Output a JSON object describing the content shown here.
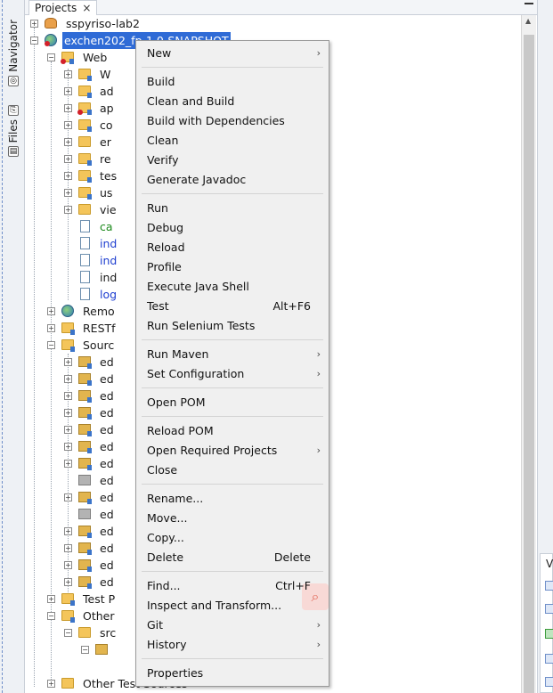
{
  "sidebar_left": {
    "navigator_label": "Navigator",
    "files_label": "Files"
  },
  "panel": {
    "tab_label": "Projects",
    "close_glyph": "×"
  },
  "tree": {
    "project1": "sspyriso-lab2",
    "project2": "exchen202_fp-1.0-SNAPSHOT",
    "web": "Web",
    "web_children": [
      "W",
      "ad",
      "ap",
      "co",
      "er",
      "re",
      "tes",
      "us",
      "vie"
    ],
    "web_files": [
      "ca",
      "ind",
      "ind",
      "ind",
      "log"
    ],
    "remote": "Remo",
    "rest": "RESTf",
    "source": "Sourc",
    "packages": [
      "ed",
      "ed",
      "ed",
      "ed",
      "ed",
      "ed",
      "ed",
      "ed",
      "ed",
      "ed",
      "ed",
      "ed",
      "ed",
      "ed"
    ],
    "testp": "Test P",
    "other1": "Other",
    "src": "src",
    "other_test": "Other Test Sources"
  },
  "context_menu": {
    "new": "New",
    "build": "Build",
    "clean_build": "Clean and Build",
    "build_deps": "Build with Dependencies",
    "clean": "Clean",
    "verify": "Verify",
    "javadoc": "Generate Javadoc",
    "run": "Run",
    "debug": "Debug",
    "reload": "Reload",
    "profile": "Profile",
    "java_shell": "Execute Java Shell",
    "test": "Test",
    "test_shortcut": "Alt+F6",
    "selenium": "Run Selenium Tests",
    "run_maven": "Run Maven",
    "set_config": "Set Configuration",
    "open_pom": "Open POM",
    "reload_pom": "Reload POM",
    "open_required": "Open Required Projects",
    "close": "Close",
    "rename": "Rename...",
    "move": "Move...",
    "copy": "Copy...",
    "delete": "Delete",
    "delete_shortcut": "Delete",
    "find": "Find...",
    "find_shortcut": "Ctrl+F",
    "inspect": "Inspect and Transform...",
    "git": "Git",
    "history": "History",
    "properties": "Properties",
    "submenu_arrow": "›"
  },
  "right_pane_label": "V"
}
